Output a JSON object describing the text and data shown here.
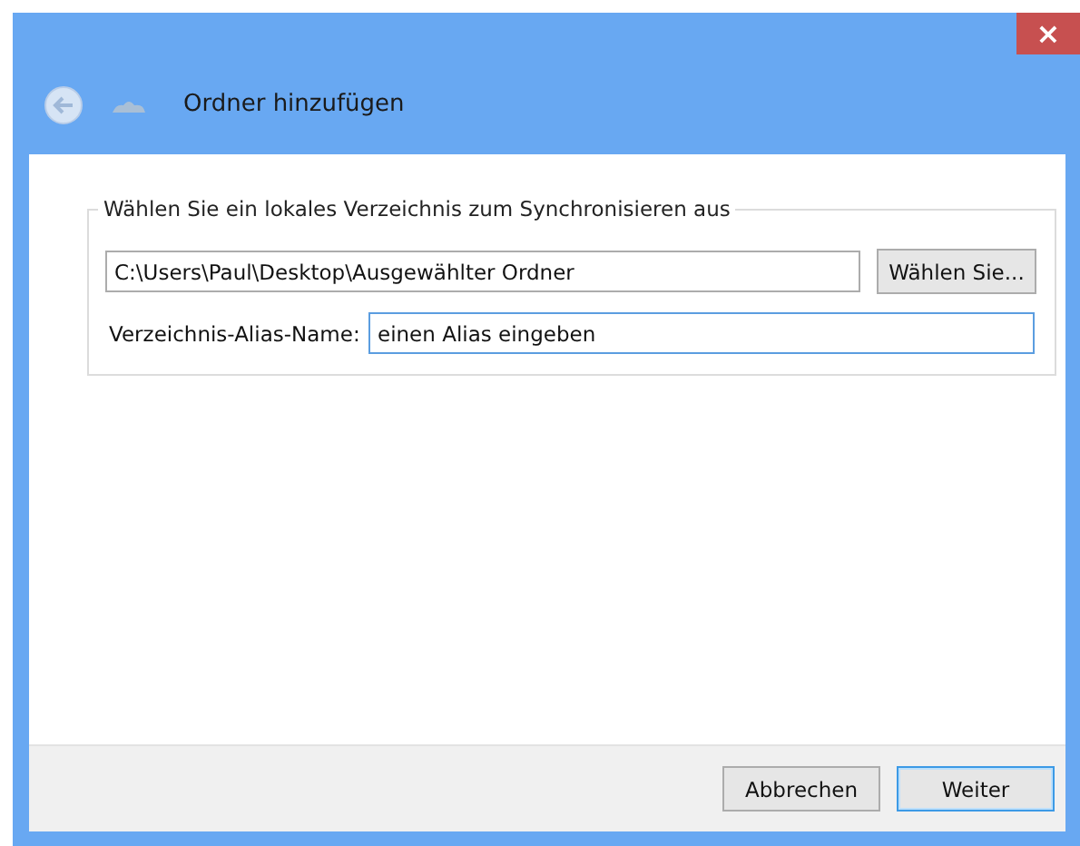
{
  "window": {
    "title": "Ordner hinzufügen",
    "close": "×"
  },
  "group": {
    "legend": "Wählen Sie ein lokales Verzeichnis zum Synchronisieren aus",
    "path": {
      "value": "C:\\Users\\Paul\\Desktop\\Ausgewählter Ordner"
    },
    "browse_button": "Wählen Sie...",
    "alias": {
      "label": "Verzeichnis-Alias-Name:",
      "value": "einen Alias eingeben",
      "focused": true
    }
  },
  "buttons": [
    {
      "label": "Abbrechen",
      "default": false
    },
    {
      "label": "Weiter",
      "default": true
    }
  ]
}
